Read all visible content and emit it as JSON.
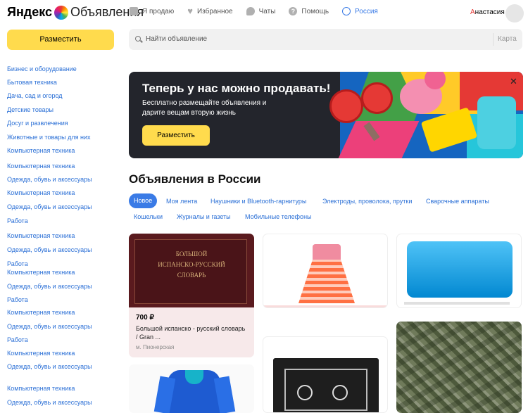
{
  "header": {
    "logo_brand": "Яндекс",
    "logo_product": "Объявления",
    "nav": [
      {
        "label": "Я продаю",
        "icon": "tag-icon"
      },
      {
        "label": "Избранное",
        "icon": "heart-icon"
      },
      {
        "label": "Чаты",
        "icon": "chat-icon"
      },
      {
        "label": "Помощь",
        "icon": "help-icon"
      }
    ],
    "help_glyph": "?",
    "region": "Россия",
    "user_first_letter": "А",
    "user_rest": "настасия"
  },
  "sidebar": {
    "post_button": "Разместить",
    "categories": [
      "Бизнес и оборудование",
      "Бытовая техника",
      "Дача, сад и огород",
      "Детские товары",
      "Досуг и развлечения",
      "Животные и товары для них",
      "Компьютерная техника",
      "Компьютерная техника",
      "Одежда, обувь и аксессуары",
      "Компьютерная техника",
      "Одежда, обувь и аксессуары",
      "Работа",
      "Компьютерная техника",
      "Одежда, обувь и аксессуары",
      "Работа",
      "Компьютерная техника",
      "Одежда, обувь и аксессуары",
      "Работа",
      "Компьютерная техника",
      "Одежда, обувь и аксессуары",
      "Работа",
      "Компьютерная техника",
      "Одежда, обувь и аксессуары",
      "Компьютерная техника",
      "Одежда, обувь и аксессуары"
    ]
  },
  "search": {
    "placeholder": "Найти объявление",
    "map_label": "Карта"
  },
  "banner": {
    "headline": "Теперь у нас можно продавать!",
    "subtext": "Бесплатно размещайте объявления и дарите вещам вторую жизнь",
    "button": "Разместить",
    "close": "✕"
  },
  "feed": {
    "title": "Объявления в России",
    "chips": [
      "Новое",
      "Моя лента",
      "Наушники и Bluetooth-гарнитуры",
      "Электроды, проволока, прутки",
      "Сварочные аппараты",
      "Кошельки",
      "Журналы и газеты",
      "Мобильные телефоны"
    ],
    "active_chip": "Новое",
    "book_cover": [
      "БОЛЬШОЙ",
      "ИСПАНСКО-РУССКИЙ",
      "СЛОВАРЬ"
    ],
    "card1": {
      "price": "700 ₽",
      "title": "Большой испанско - русский словарь / Gran ...",
      "location": "м. Пионерская"
    }
  },
  "colors": {
    "accent_yellow": "#ffdb4d",
    "link_blue": "#2a6fd6",
    "chip_active": "#3a7be6",
    "banner_bg": "#23252c"
  }
}
